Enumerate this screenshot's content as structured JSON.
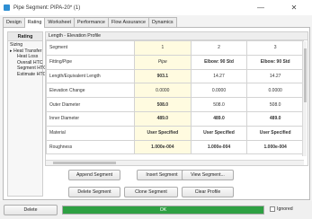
{
  "window": {
    "title": "Pipe Segment: PIPA-20* (1)",
    "min_glyph": "—",
    "close_glyph": "✕"
  },
  "tabs": [
    {
      "label": "Design"
    },
    {
      "label": "Rating"
    },
    {
      "label": "Worksheet"
    },
    {
      "label": "Performance"
    },
    {
      "label": "Flow Assurance"
    },
    {
      "label": "Dynamics"
    }
  ],
  "sidebar": {
    "header": "Rating",
    "items": [
      {
        "label": "Sizing"
      },
      {
        "label": "▸ Heat Transfer"
      },
      {
        "label": "Heat Loss"
      },
      {
        "label": "Overall HTC"
      },
      {
        "label": "Segment HTC"
      },
      {
        "label": "Estimate HTC"
      }
    ]
  },
  "grid": {
    "title": "Length - Elevation Profile",
    "header_row": {
      "label": "Segment",
      "values": [
        "1",
        "2",
        "3"
      ]
    },
    "rows": [
      {
        "label": "Fitting/Pipe",
        "values": [
          "Pipe",
          "Elbow: 90 Std",
          "Elbow: 90 Std"
        ]
      },
      {
        "label": "Length/Equivalent Length",
        "values": [
          "903.1",
          "14.27",
          "14.27"
        ]
      },
      {
        "label": "Elevation Change",
        "values": [
          "0.0000",
          "0.0000",
          "0.0000"
        ]
      },
      {
        "label": "Outer Diameter",
        "values": [
          "508.0",
          "508.0",
          "508.0"
        ]
      },
      {
        "label": "Inner Diameter",
        "values": [
          "489.0",
          "489.0",
          "489.0"
        ]
      },
      {
        "label": "Material",
        "values": [
          "User Specified",
          "User Specified",
          "User Specified"
        ]
      },
      {
        "label": "Roughness",
        "values": [
          "1.000e-004",
          "1.000e-004",
          "1.000e-004"
        ]
      }
    ]
  },
  "buttons": {
    "append": "Append Segment",
    "insert": "Insert Segment",
    "view": "View Segment...",
    "delete_segment": "Delete Segment",
    "clone": "Clone Segment",
    "clear": "Clear Profile"
  },
  "footer": {
    "delete_label": "Delete",
    "status_text": "OK",
    "progress_fraction": 1.0,
    "ignored_label": "Ignored"
  },
  "colors": {
    "progress": "#2ea043",
    "accent": "#2e8fd3"
  }
}
